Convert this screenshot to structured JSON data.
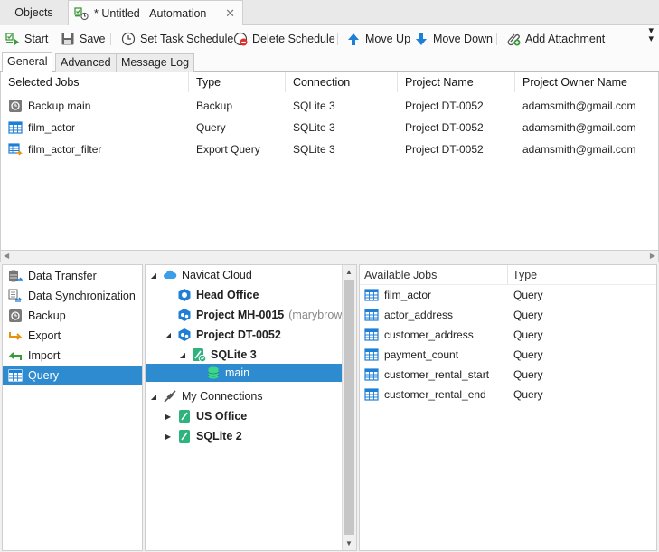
{
  "window": {
    "tabs": [
      {
        "label": "Objects"
      },
      {
        "label": "* Untitled - Automation"
      }
    ]
  },
  "toolbar": {
    "start": "Start",
    "save": "Save",
    "set_task_schedule": "Set Task Schedule",
    "delete_schedule": "Delete Schedule",
    "move_up": "Move Up",
    "move_down": "Move Down",
    "add_attachment": "Add Attachment"
  },
  "subtabs": [
    "General",
    "Advanced",
    "Message Log"
  ],
  "jobs_table": {
    "columns": [
      "Selected Jobs",
      "Type",
      "Connection",
      "Project Name",
      "Project Owner Name"
    ],
    "rows": [
      {
        "icon": "backup-icon",
        "name": "Backup main",
        "type": "Backup",
        "connection": "SQLite 3",
        "project": "Project DT-0052",
        "owner": "adamsmith@gmail.com"
      },
      {
        "icon": "query-icon",
        "name": "film_actor",
        "type": "Query",
        "connection": "SQLite 3",
        "project": "Project DT-0052",
        "owner": "adamsmith@gmail.com"
      },
      {
        "icon": "export-query-icon",
        "name": "film_actor_filter",
        "type": "Export Query",
        "connection": "SQLite 3",
        "project": "Project DT-0052",
        "owner": "adamsmith@gmail.com"
      }
    ]
  },
  "job_types": [
    {
      "label": "Data Transfer",
      "icon": "data-transfer-icon"
    },
    {
      "label": "Data Synchronization",
      "icon": "data-sync-icon"
    },
    {
      "label": "Backup",
      "icon": "backup-icon"
    },
    {
      "label": "Export",
      "icon": "export-icon"
    },
    {
      "label": "Import",
      "icon": "import-icon"
    },
    {
      "label": "Query",
      "icon": "query-icon",
      "selected": true
    }
  ],
  "tree": {
    "navicat_cloud": "Navicat Cloud",
    "head_office": "Head Office",
    "project_mh": "Project MH-0015",
    "project_mh_owner": "(marybrow",
    "project_dt": "Project DT-0052",
    "sqlite3": "SQLite 3",
    "main": "main",
    "my_connections": "My Connections",
    "us_office": "US Office",
    "sqlite2": "SQLite 2"
  },
  "available_jobs": {
    "columns": [
      "Available Jobs",
      "Type"
    ],
    "rows": [
      {
        "name": "film_actor",
        "type": "Query"
      },
      {
        "name": "actor_address",
        "type": "Query"
      },
      {
        "name": "customer_address",
        "type": "Query"
      },
      {
        "name": "payment_count",
        "type": "Query"
      },
      {
        "name": "customer_rental_start",
        "type": "Query"
      },
      {
        "name": "customer_rental_end",
        "type": "Query"
      }
    ]
  },
  "colors": {
    "selection": "#2e8bd0",
    "accent_blue": "#1e7fd6",
    "sqlite_green": "#2fb37c"
  }
}
